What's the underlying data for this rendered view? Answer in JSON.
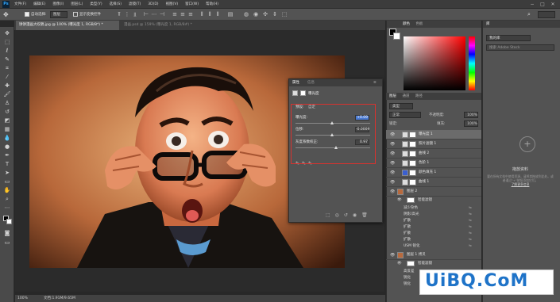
{
  "menubar": {
    "logo": "Ps",
    "items": [
      "文件(F)",
      "编辑(E)",
      "图像(I)",
      "图层(L)",
      "类型(Y)",
      "选择(S)",
      "滤镜(T)",
      "3D(D)",
      "视图(V)",
      "窗口(W)",
      "帮助(H)"
    ],
    "window_buttons": [
      "−",
      "□",
      "✕"
    ]
  },
  "options": {
    "auto_select_label": "自动选择:",
    "auto_select_value": "图层",
    "show_transform_label": "显示变换控件"
  },
  "tabs": {
    "active": "饼饼漫画大叹稿.jpg @ 100% (曝光度 1, RGB/8*) *",
    "inactive": "漫画.psd @ 159% (曝光度 1, RGB/8#) *"
  },
  "status": {
    "zoom": "100%",
    "doc": "文档:1.91M/9.65M"
  },
  "properties": {
    "tab_active": "属性",
    "tab_inactive": "信息",
    "subtitle": "曝光度",
    "preset_label": "预设:",
    "preset_value": "自定",
    "exposure_label": "曝光度:",
    "exposure_value": "+0.09",
    "offset_label": "位移:",
    "offset_value": "-0.0009",
    "gamma_label": "灰度系数校正:",
    "gamma_value": "0.97"
  },
  "color_panel": {
    "tab_active": "颜色",
    "tab_inactive": "色板"
  },
  "layers_panel": {
    "tabs": [
      "图层",
      "通道",
      "路径"
    ],
    "kind": "类型",
    "blend_mode": "正常",
    "opacity_label": "不透明度:",
    "opacity_value": "100%",
    "lock_label": "锁定:",
    "fill_label": "填充:",
    "fill_value": "100%",
    "layers": [
      {
        "name": "曝光度 1",
        "active": true
      },
      {
        "name": "照片滤镜 1",
        "active": false
      },
      {
        "name": "曲线 2",
        "active": false
      },
      {
        "name": "色阶 1",
        "active": false
      },
      {
        "name": "颜色填充 1",
        "active": false
      },
      {
        "name": "曲线 1",
        "active": false
      }
    ],
    "group1_name": "图层 2",
    "smart_filter_label": "智能滤镜",
    "filters1": [
      "减少杂色",
      "阴影/高光",
      "扩散",
      "扩散",
      "扩散",
      "扩散",
      "USM 锐化"
    ],
    "group2_name": "图层 1 拷贝",
    "filters2": [
      "高反差",
      "锐化",
      "锐化"
    ]
  },
  "libraries": {
    "tab": "库",
    "select_value": "我的库",
    "search_placeholder": "搜索 Adobe Stock",
    "plus": "+",
    "drag_title": "拖放资料",
    "drag_desc": "要在所有文档中使用资源，请将其拖放到此处。或者通过\"+\"按钮添加它们。",
    "more": "了解更多信息"
  },
  "watermark": "UiBQ.CoM"
}
